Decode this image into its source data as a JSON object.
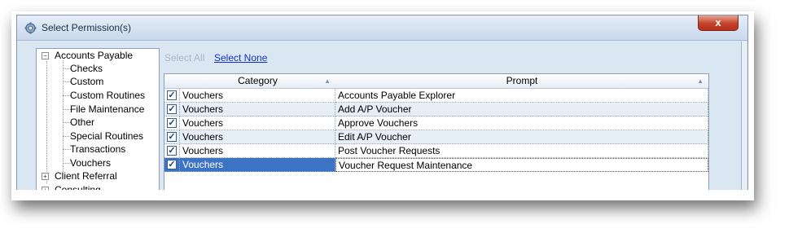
{
  "window": {
    "title": "Select Permission(s)",
    "close_label": "x"
  },
  "tree": {
    "items": [
      {
        "label": "Accounts Payable",
        "expander": "−"
      },
      {
        "label": "Checks"
      },
      {
        "label": "Custom"
      },
      {
        "label": "Custom Routines"
      },
      {
        "label": "File Maintenance"
      },
      {
        "label": "Other"
      },
      {
        "label": "Special Routines"
      },
      {
        "label": "Transactions"
      },
      {
        "label": "Vouchers"
      },
      {
        "label": "Client Referral",
        "expander": "+"
      },
      {
        "label": "Consulting",
        "expander": "+"
      }
    ]
  },
  "toolbar": {
    "select_all": "Select All",
    "select_none": "Select None"
  },
  "grid": {
    "columns": [
      "Category",
      "Prompt"
    ],
    "rows": [
      {
        "checked": "✓",
        "category": "Vouchers",
        "prompt": "Accounts Payable Explorer"
      },
      {
        "checked": "✓",
        "category": "Vouchers",
        "prompt": "Add A/P Voucher"
      },
      {
        "checked": "✓",
        "category": "Vouchers",
        "prompt": "Approve Vouchers"
      },
      {
        "checked": "✓",
        "category": "Vouchers",
        "prompt": "Edit A/P Voucher"
      },
      {
        "checked": "✓",
        "category": "Vouchers",
        "prompt": "Post Voucher Requests"
      },
      {
        "checked": "✓",
        "category": "Vouchers",
        "prompt": "Voucher Request Maintenance"
      }
    ]
  },
  "colors": {
    "selection": "#3d73c4",
    "link": "#1034c9",
    "close": "#c4412b"
  }
}
